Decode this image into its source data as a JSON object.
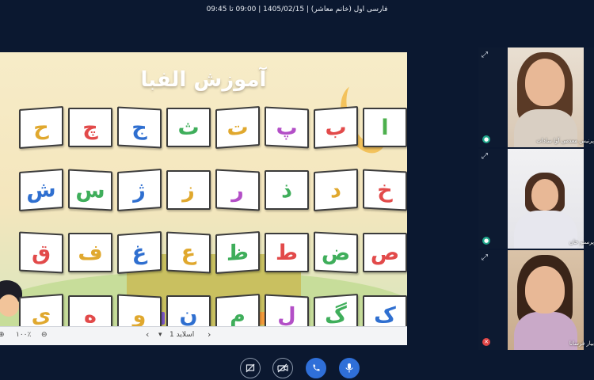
{
  "window_title": "فارسی اول (خانم معاشر) | 1405/02/15 | 09:00 تا 09:45",
  "slide": {
    "title": "آموزش الفبا",
    "cards": [
      {
        "letter": "ا",
        "color": "#4db04d"
      },
      {
        "letter": "ب",
        "color": "#e24a4a"
      },
      {
        "letter": "پ",
        "color": "#b34fc7"
      },
      {
        "letter": "ت",
        "color": "#e0a82e"
      },
      {
        "letter": "ث",
        "color": "#3fae5b"
      },
      {
        "letter": "ج",
        "color": "#2f6fd0"
      },
      {
        "letter": "چ",
        "color": "#e24a4a"
      },
      {
        "letter": "ح",
        "color": "#e0a82e"
      },
      {
        "letter": "خ",
        "color": "#e24a4a"
      },
      {
        "letter": "د",
        "color": "#e0a82e"
      },
      {
        "letter": "ذ",
        "color": "#3fae5b"
      },
      {
        "letter": "ر",
        "color": "#b34fc7"
      },
      {
        "letter": "ز",
        "color": "#e0a82e"
      },
      {
        "letter": "ژ",
        "color": "#2f6fd0"
      },
      {
        "letter": "س",
        "color": "#3fae5b"
      },
      {
        "letter": "ش",
        "color": "#2f6fd0"
      },
      {
        "letter": "ص",
        "color": "#e24a4a"
      },
      {
        "letter": "ض",
        "color": "#3fae5b"
      },
      {
        "letter": "ط",
        "color": "#e24a4a"
      },
      {
        "letter": "ظ",
        "color": "#3fae5b"
      },
      {
        "letter": "ع",
        "color": "#e0a82e"
      },
      {
        "letter": "غ",
        "color": "#2f6fd0"
      },
      {
        "letter": "ف",
        "color": "#e0a82e"
      },
      {
        "letter": "ق",
        "color": "#e24a4a"
      },
      {
        "letter": "ک",
        "color": "#2f6fd0"
      },
      {
        "letter": "گ",
        "color": "#3fae5b"
      },
      {
        "letter": "ل",
        "color": "#b34fc7"
      },
      {
        "letter": "م",
        "color": "#3fae5b"
      },
      {
        "letter": "ن",
        "color": "#2f6fd0"
      },
      {
        "letter": "و",
        "color": "#e0a82e"
      },
      {
        "letter": "ه",
        "color": "#e24a4a"
      },
      {
        "letter": "ی",
        "color": "#e0a82e"
      }
    ]
  },
  "slide_toolbar": {
    "slide_label": "اسلاید 1",
    "zoom": "۱۰۰٪"
  },
  "participants": [
    {
      "name": "پرنیس معدمی آوا سادات",
      "mic": "on",
      "mic_color": "#1fa58a"
    },
    {
      "name": "پرستو خان",
      "mic": "on",
      "mic_color": "#1fa58a"
    },
    {
      "name": "بیار فرسانا",
      "mic": "off",
      "mic_color": "#e04545"
    }
  ],
  "controls": [
    "screen-share",
    "camera-off",
    "phone",
    "microphone"
  ]
}
